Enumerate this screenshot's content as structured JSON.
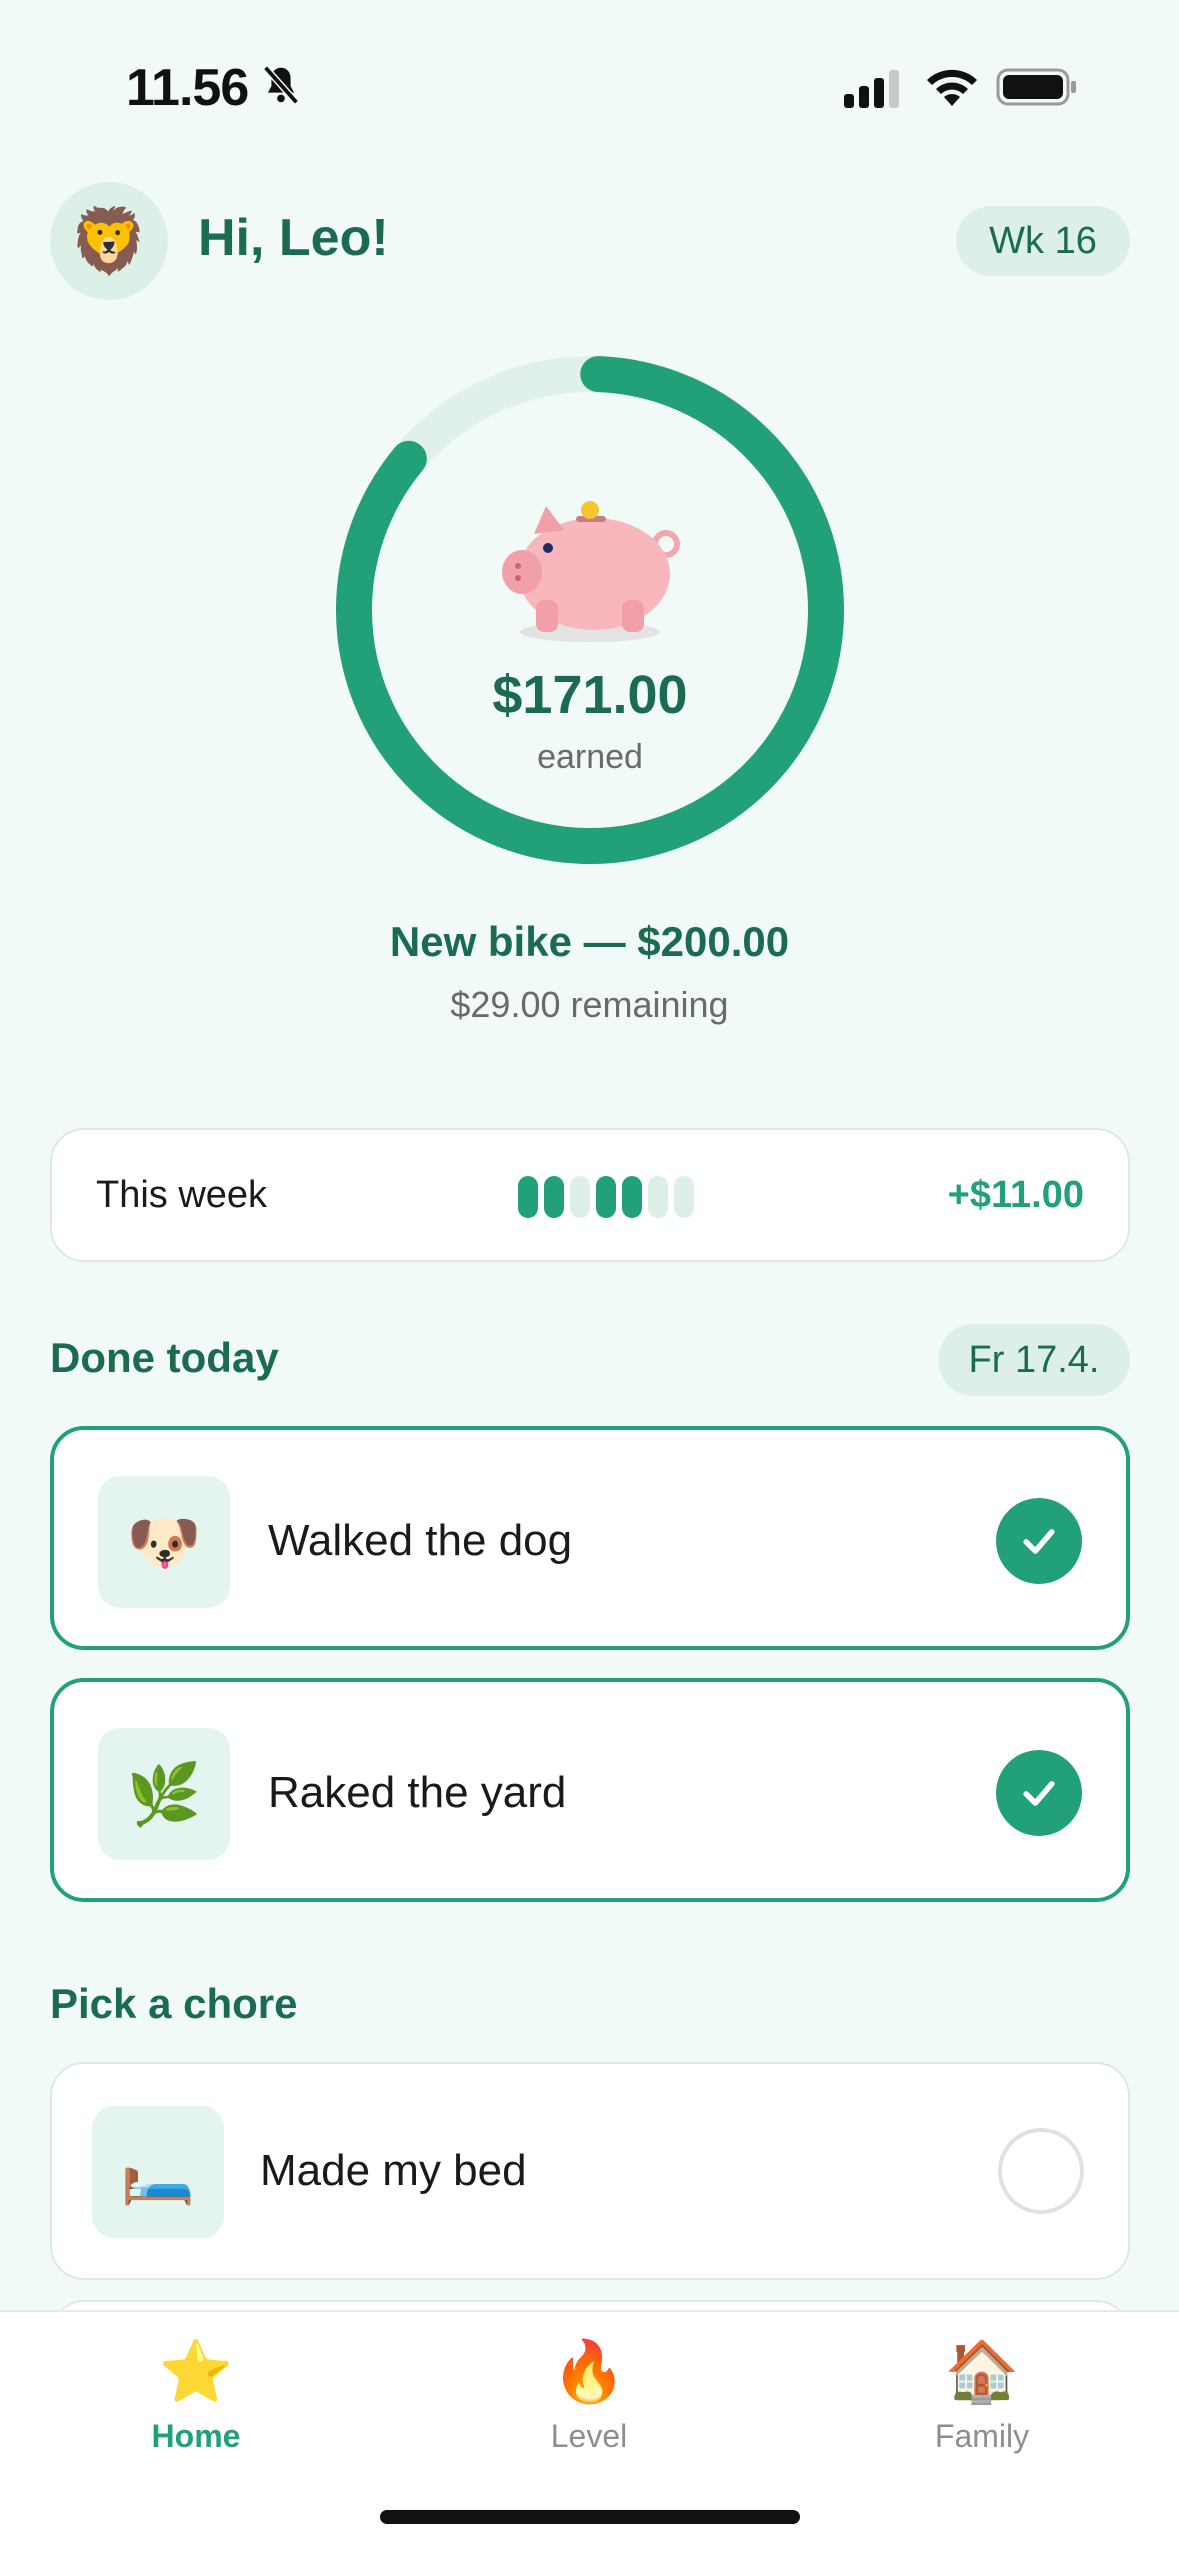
{
  "status_bar": {
    "time": "11.56",
    "icons": [
      "bell-slash-icon",
      "signal-icon",
      "wifi-icon",
      "battery-icon"
    ]
  },
  "header": {
    "avatar_emoji": "🦁",
    "greeting": "Hi, Leo!",
    "week_badge": "Wk 16"
  },
  "savings": {
    "amount": "$171.00",
    "amount_label": "earned",
    "progress_fraction": 0.855,
    "goal_title": "New bike — $200.00",
    "goal_remaining": "$29.00 remaining"
  },
  "week_summary": {
    "label": "This week",
    "days": [
      true,
      true,
      false,
      true,
      true,
      false,
      false
    ],
    "gain": "+$11.00"
  },
  "done_today": {
    "title": "Done today",
    "date": "Fr 17.4.",
    "items": [
      {
        "emoji": "🐶",
        "label": "Walked the dog",
        "done": true
      },
      {
        "emoji": "🌿",
        "label": "Raked the yard",
        "done": true
      }
    ]
  },
  "pick_chore": {
    "title": "Pick a chore",
    "items": [
      {
        "emoji": "🛏️",
        "label": "Made my bed",
        "done": false
      }
    ]
  },
  "tab_bar": {
    "tabs": [
      {
        "emoji": "⭐",
        "label": "Home",
        "active": true
      },
      {
        "emoji": "🔥",
        "label": "Level",
        "active": false
      },
      {
        "emoji": "🏠",
        "label": "Family",
        "active": false
      }
    ]
  },
  "colors": {
    "accent": "#22a07a",
    "accent_dark": "#1b6b54",
    "background": "#f1faf7",
    "badge_bg": "#dcf0e8"
  }
}
